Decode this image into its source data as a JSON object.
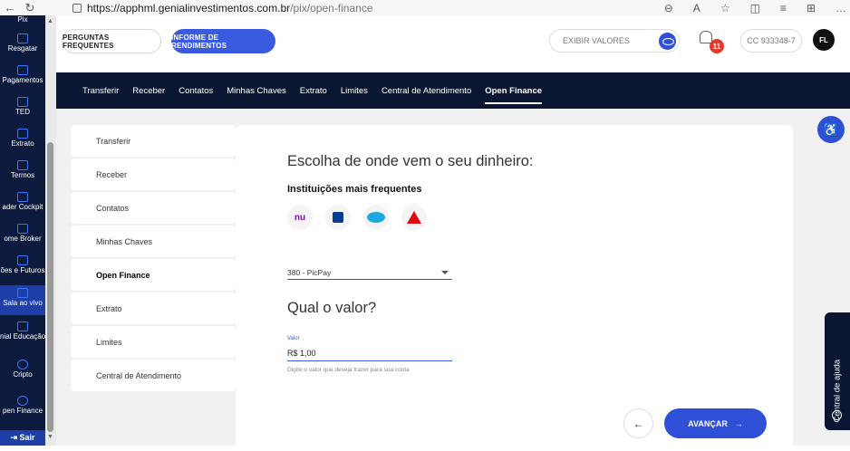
{
  "browser": {
    "url_host": "https://apphml.genialinvestimentos.com.br",
    "url_path": "/pix/open-finance"
  },
  "sidebar": {
    "items": [
      {
        "label": "Pix"
      },
      {
        "label": "Resgatar"
      },
      {
        "label": "Pagamentos"
      },
      {
        "label": "TED"
      },
      {
        "label": "Extrato"
      },
      {
        "label": "Termos"
      },
      {
        "label": "ader Cockpit"
      },
      {
        "label": "ome Broker"
      },
      {
        "label": "ões e Futuros"
      },
      {
        "label": "Sala ao vivo"
      },
      {
        "label": "nial Educação"
      },
      {
        "label": "Cripto"
      },
      {
        "label": "pen Finance"
      },
      {
        "label": "Sair"
      }
    ]
  },
  "header": {
    "faq_label": "PERGUNTAS FREQUENTES",
    "informe_label": "INFORME DE RENDIMENTOS",
    "exibir_label": "EXIBIR VALORES",
    "notif_count": "11",
    "account": "CC 933348-7",
    "avatar": "FL"
  },
  "nav": {
    "items": [
      "Transferir",
      "Receber",
      "Contatos",
      "Minhas Chaves",
      "Extrato",
      "Limites",
      "Central de Atendimento",
      "Open Finance"
    ]
  },
  "menu": {
    "items": [
      "Transferir",
      "Receber",
      "Contatos",
      "Minhas Chaves",
      "Open Finance",
      "Extrato",
      "Limites",
      "Central de Atendimento"
    ]
  },
  "form": {
    "title": "Escolha de onde vem o seu dinheiro:",
    "subtitle": "Instituições mais frequentes",
    "bank_nu": "nu",
    "selected_bank": "380 - PicPay",
    "value_title": "Qual o valor?",
    "value_label": "Valor",
    "value": "R$  1,00",
    "hint": "Digite o valor que deseja trazer para sua conta",
    "advance_label": "AVANÇAR",
    "advance_arrow": "→",
    "back_arrow": "←"
  },
  "help": {
    "label": "Central de ajuda"
  },
  "colors": {
    "primary": "#2f4fd6",
    "navy": "#0b1632",
    "sidebar": "#0b1a3d"
  }
}
